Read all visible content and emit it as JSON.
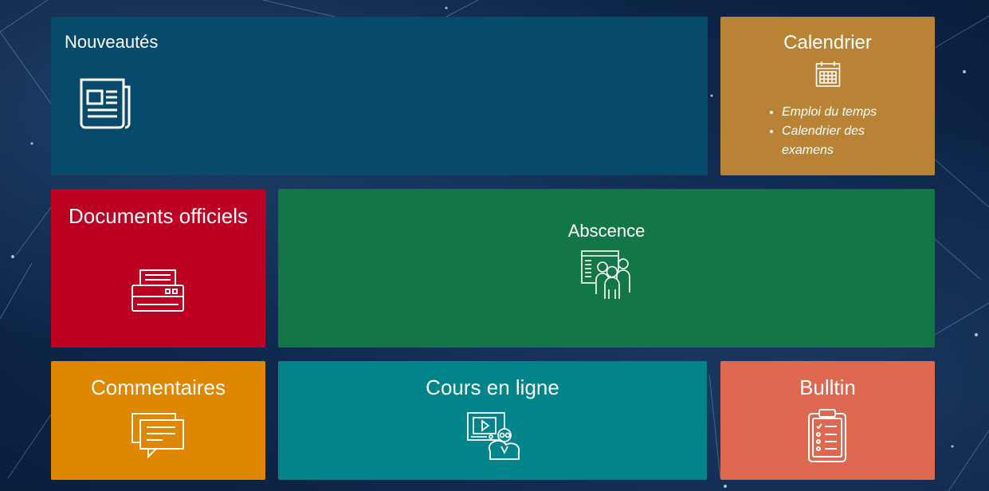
{
  "tiles": {
    "news": {
      "title": "Nouveautés",
      "icon": "newspaper-icon",
      "color": "#074a6c"
    },
    "calendar": {
      "title": "Calendrier",
      "icon": "calendar-icon",
      "color": "#b88335",
      "links": [
        "Emploi du temps",
        "Calendrier des examens"
      ]
    },
    "documents": {
      "title": "Documents officiels",
      "icon": "printer-icon",
      "color": "#bd0123"
    },
    "absence": {
      "title": "Abscence",
      "icon": "attendance-group-icon",
      "color": "#137647"
    },
    "comments": {
      "title": "Commentaires",
      "icon": "chat-bubbles-icon",
      "color": "#e08700"
    },
    "courses": {
      "title": "Cours en ligne",
      "icon": "online-teacher-icon",
      "color": "#01848a"
    },
    "bulletin": {
      "title": "Bulltin",
      "icon": "clipboard-checklist-icon",
      "color": "#dd674f"
    }
  }
}
